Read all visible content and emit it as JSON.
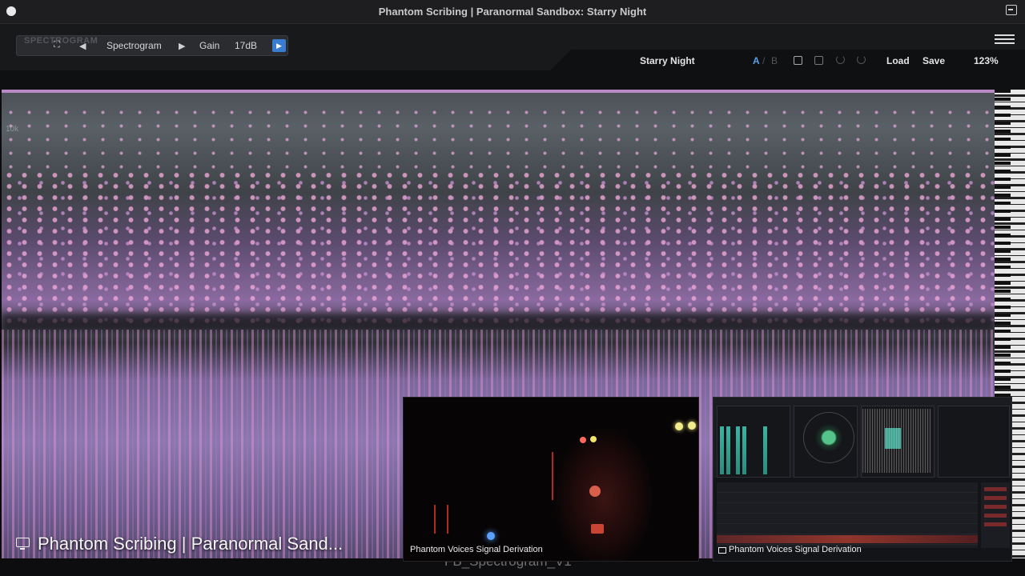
{
  "window": {
    "title": "Phantom Scribing | Paranormal Sandbox: Starry Night"
  },
  "plugin": {
    "logo": "SPECTROGRAM",
    "view_label": "Spectrogram",
    "gain_label": "Gain",
    "gain_value": "17dB"
  },
  "preset": {
    "name": "Starry Night",
    "a_label": "A",
    "b_label": "B",
    "load_label": "Load",
    "save_label": "Save",
    "zoom": "123%"
  },
  "spectrogram": {
    "freq_labels": [
      "10k"
    ]
  },
  "overlay": {
    "main_caption": "Phantom Scribing | Paranormal Sand...",
    "bottom_text": "FB_Spectrogram_V1"
  },
  "tiles": {
    "camera_caption": "Phantom Voices Signal Derivation",
    "meter_caption": "Phantom Voices Signal Derivation"
  },
  "colors": {
    "accent": "#3a7cd0",
    "spectrogram_pink": "#e4a6d8",
    "meter_teal": "#3bb3a2"
  }
}
